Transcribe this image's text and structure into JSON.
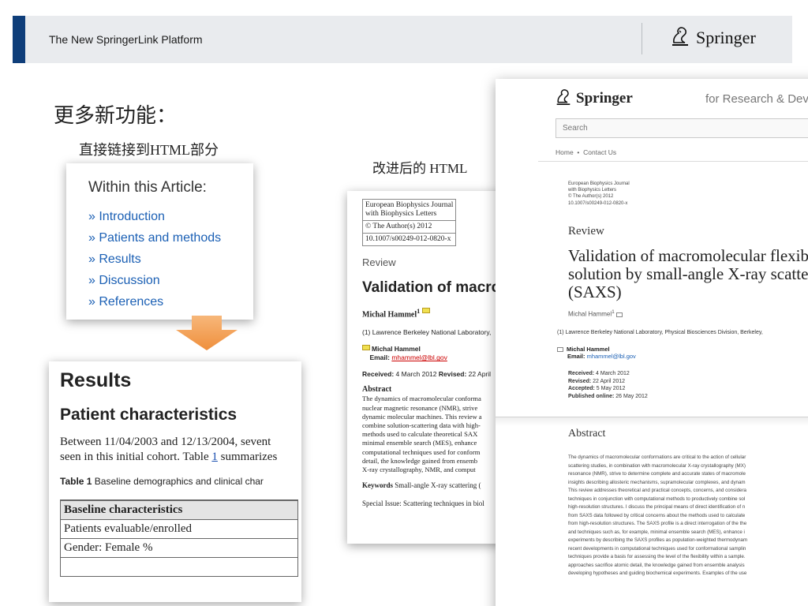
{
  "header": {
    "title": "The New SpringerLink Platform",
    "logo_text": "Springer"
  },
  "main_heading": "更多新功能：",
  "sub_heading": "直接链接到HTML部分",
  "caption_html": "改进后的 HTML",
  "toc": {
    "title": "Within this Article:",
    "links": [
      "» Introduction",
      "» Patients and methods",
      "» Results",
      "» Discussion",
      "» References"
    ]
  },
  "results_panel": {
    "heading": "Results",
    "subheading": "Patient characteristics",
    "para_1a": "Between 11/04/2003 and 12/13/2004, sevent",
    "para_2a": "seen in this initial cohort. Table ",
    "para_link": "1",
    "para_2b": " summarizes",
    "table_label": "Table 1",
    "table_caption": "  Baseline demographics and clinical char",
    "rows": [
      "Baseline characteristics",
      "Patients evaluable/enrolled",
      "Gender: Female %",
      ""
    ]
  },
  "html_page": {
    "journal_line1": "European Biophysics Journal",
    "journal_line2": "with Biophysics Letters",
    "copyright": "© The Author(s) 2012",
    "doi": "10.1007/s00249-012-0820-x",
    "section": "Review",
    "title": "Validation of macro",
    "author": "Michal Hammel",
    "affiliation": "(1)  Lawrence Berkeley National Laboratory,",
    "contact_name": "Michal Hammel",
    "contact_email_label": "Email: ",
    "contact_email": "mhammel@lbl.gov",
    "received_label": "Received:",
    "received": " 4 March 2012  ",
    "revised_label": "Revised:",
    "revised": " 22 April",
    "abstract_heading": "Abstract",
    "abstract_lines": [
      "The dynamics of macromolecular conforma",
      "nuclear magnetic resonance (NMR), strive",
      "dynamic molecular machines. This review a",
      "combine solution-scattering data with high-",
      "methods used to calculate theoretical SAX",
      "minimal ensemble search (MES), enhance",
      "computational techniques used for conform",
      "detail, the knowledge gained from ensemb",
      "X-ray crystallography, NMR, and comput"
    ],
    "keywords_label": "Keywords",
    "keywords": "  Small-angle X-ray scattering (",
    "special_issue": "Special Issue: Scattering techniques in biol"
  },
  "springer_page": {
    "logo_text": "Springer",
    "tagline": "for Research & Deve",
    "search_placeholder": "Search",
    "nav_home": "Home",
    "nav_sep": "•",
    "nav_contact": "Contact Us",
    "meta_lines": [
      "European Biophysics Journal",
      "with Biophysics Letters",
      "© The Author(s) 2012",
      "10.1007/s00249-012-0820-x"
    ],
    "section": "Review",
    "title_lines": [
      "Validation of macromolecular flexib",
      "solution by small-angle X-ray scatte",
      "(SAXS)"
    ],
    "author": "Michal Hammel",
    "affiliation": "(1)  Lawrence Berkeley National Laboratory, Physical Biosciences Division, Berkeley,",
    "mail_name": "Michal Hammel",
    "mail_label": "Email: ",
    "mail_address": "mhammel@lbl.gov",
    "received_label": "Received:",
    "received": " 4 March 2012",
    "revised_label": "Revised:",
    "revised": " 22 April 2012",
    "accepted_label": "Accepted:",
    "accepted": " 5 May 2012",
    "published_label": "Published online:",
    "published": " 26 May 2012",
    "abstract_heading": "Abstract",
    "abstract_lines": [
      "The dynamics of macromolecular conformations are critical to the action of cellular",
      "scattering studies, in combination with macromolecular X-ray crystallography (MX)",
      "resonance (NMR), strive to determine complete and accurate states of macromole",
      "insights describing allosteric mechanisms, supramolecular complexes, and dynam",
      "This review addresses theoretical and practical concepts, concerns, and considera",
      "techniques in conjunction with computational methods to productively combine sol",
      "high-resolution structures. I discuss the principal means of direct identification of n",
      "from SAXS data followed by critical concerns about the methods used to calculate",
      "from high-resolution structures. The SAXS profile is a direct interrogation of the the",
      "and techniques such as, for example, minimal ensemble search (MES), enhance i",
      "experiments by describing the SAXS profiles as population-weighted thermodynam",
      "recent developments in computational techniques used for conformational samplin",
      "techniques provide a basis for assessing the level of the flexibility within a sample.",
      "approaches sacrifice atomic detail, the knowledge gained from ensemble analysis",
      "developing hypotheses and guiding biochemical experiments. Examples of the use"
    ]
  },
  "colors": {
    "header_bg": "#e9ebee",
    "header_accent": "#0f3e7a",
    "link_blue": "#1a5fb4",
    "arrow_orange": "#f4a45a"
  }
}
